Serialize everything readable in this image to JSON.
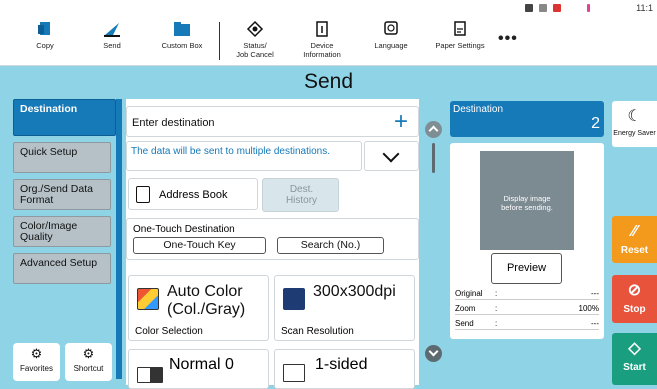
{
  "status": {
    "time": "11:1"
  },
  "toolbar": {
    "items": [
      {
        "label": "Copy"
      },
      {
        "label": "Send"
      },
      {
        "label": "Custom Box"
      },
      {
        "label": "Status/\nJob Cancel"
      },
      {
        "label": "Device\nInformation"
      },
      {
        "label": "Language"
      },
      {
        "label": "Paper Settings"
      }
    ],
    "more": "•••"
  },
  "title": "Send",
  "left_tabs": [
    {
      "label": "Destination"
    },
    {
      "label": "Quick Setup"
    },
    {
      "label": "Org./Send Data Format"
    },
    {
      "label": "Color/Image Quality"
    },
    {
      "label": "Advanced Setup"
    }
  ],
  "favorites_label": "Favorites",
  "shortcut_label": "Shortcut",
  "destination": {
    "enter_label": "Enter destination",
    "plus": "+",
    "multi_message": "The data will be sent to multiple destinations.",
    "address_book": "Address Book",
    "dest_history": "Dest.\nHistory",
    "one_touch_label": "One-Touch Destination",
    "one_touch_key": "One-Touch Key",
    "search_no": "Search (No.)"
  },
  "tiles": [
    {
      "value": "Auto Color\n(Col./Gray)",
      "caption": "Color Selection"
    },
    {
      "value": "300x300dpi",
      "caption": "Scan Resolution"
    },
    {
      "value": "Normal 0",
      "caption": ""
    },
    {
      "value": "1-sided",
      "caption": ""
    }
  ],
  "dest_panel": {
    "label": "Destination",
    "count": "2",
    "thumb_text": "Display image\nbefore sending.",
    "preview": "Preview",
    "info": [
      {
        "k": "Original",
        "v": "---"
      },
      {
        "k": "Zoom",
        "v": "100%"
      },
      {
        "k": "Send",
        "v": "---"
      }
    ]
  },
  "right": {
    "energy": "Energy Saver",
    "reset": "Reset",
    "stop": "Stop",
    "start": "Start"
  }
}
